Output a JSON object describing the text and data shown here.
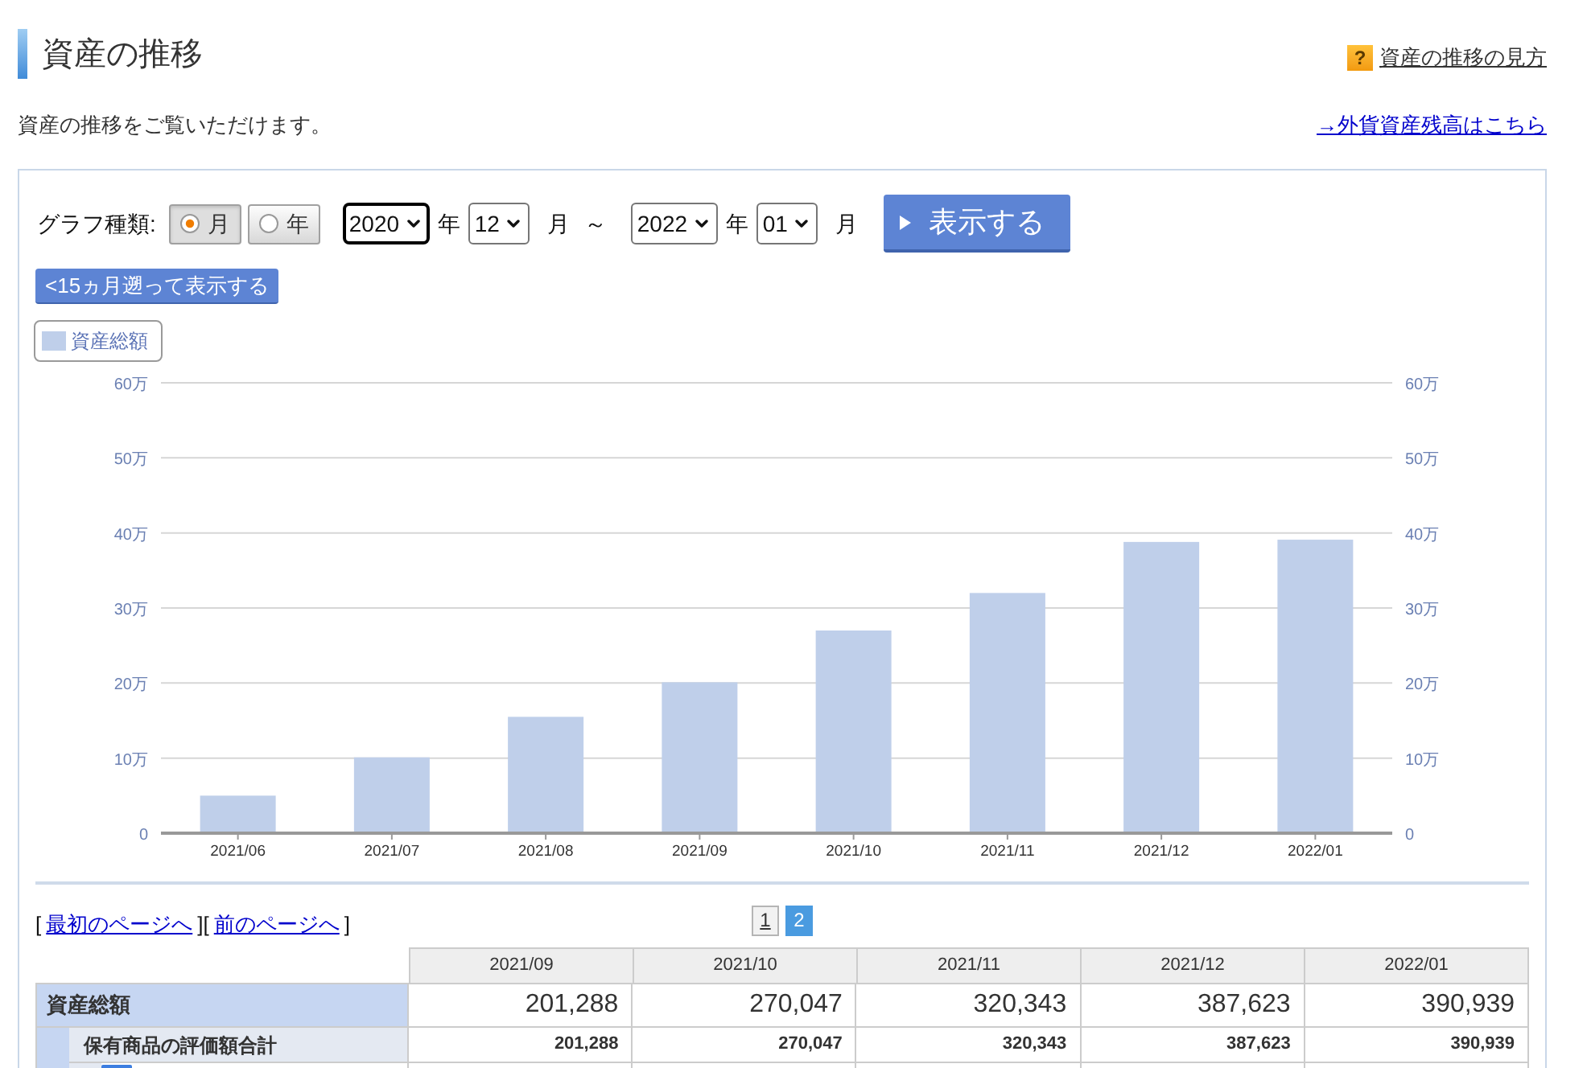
{
  "header": {
    "title": "資産の推移",
    "help_icon": "?",
    "help_link": "資産の推移の見方"
  },
  "intro": {
    "text": "資産の推移をご覧いただけます。",
    "link": "→外貨資産残高はこちら"
  },
  "controls": {
    "graph_type_label": "グラフ種類:",
    "graph_types": [
      {
        "label": "月",
        "selected": true
      },
      {
        "label": "年",
        "selected": false
      }
    ],
    "range": [
      {
        "year": {
          "value": "2020",
          "focused": true
        },
        "year_unit": "年",
        "month": {
          "value": "12",
          "focused": false
        },
        "month_unit": "月"
      },
      {
        "year": {
          "value": "2022",
          "focused": false
        },
        "year_unit": "年",
        "month": {
          "value": "01",
          "focused": false
        },
        "month_unit": "月"
      }
    ],
    "range_separator": "～",
    "submit": "表示する",
    "back_button": "<15ヵ月遡って表示する"
  },
  "chart": {
    "right_axis_labels": [
      "60万",
      "50万",
      "40万",
      "30万",
      "20万",
      "10万",
      "0"
    ],
    "chart_data": {
      "type": "bar",
      "grid": true,
      "categories": [
        "2021/06",
        "2021/07",
        "2021/08",
        "2021/09",
        "2021/10",
        "2021/11",
        "2021/12",
        "2022/01"
      ],
      "series": [
        {
          "name": "資産総額",
          "color": "#bfcfea",
          "values": [
            5.0,
            10.1,
            15.5,
            20.1,
            27.0,
            32.0,
            38.8,
            39.1
          ]
        }
      ],
      "ylim": [
        0,
        60
      ],
      "yticks": [
        {
          "value": 0,
          "label": "0"
        },
        {
          "value": 10,
          "label": "10万"
        },
        {
          "value": 20,
          "label": "20万"
        },
        {
          "value": 30,
          "label": "30万"
        },
        {
          "value": 40,
          "label": "40万"
        },
        {
          "value": 50,
          "label": "50万"
        },
        {
          "value": 60,
          "label": "60万"
        }
      ]
    }
  },
  "pagination": {
    "links": [
      {
        "before": "[",
        "label": "最初のページへ",
        "after": "]"
      },
      {
        "before": "[",
        "label": "前のページへ",
        "after": "]"
      }
    ],
    "pages": [
      {
        "label": "1",
        "selected": false
      },
      {
        "label": "2",
        "selected": true
      }
    ]
  },
  "table": {
    "columns": [
      "2021/09",
      "2021/10",
      "2021/11",
      "2021/12",
      "2022/01"
    ],
    "rows": [
      {
        "label": "資産総額",
        "values": [
          "201,288",
          "270,047",
          "320,343",
          "387,623",
          "390,939"
        ],
        "children": [
          {
            "label": "保有商品の評価額合計",
            "values": [
              "201,288",
              "270,047",
              "320,343",
              "387,623",
              "390,939"
            ],
            "children": [
              {
                "kind": "category"
              }
            ]
          }
        ]
      }
    ]
  }
}
